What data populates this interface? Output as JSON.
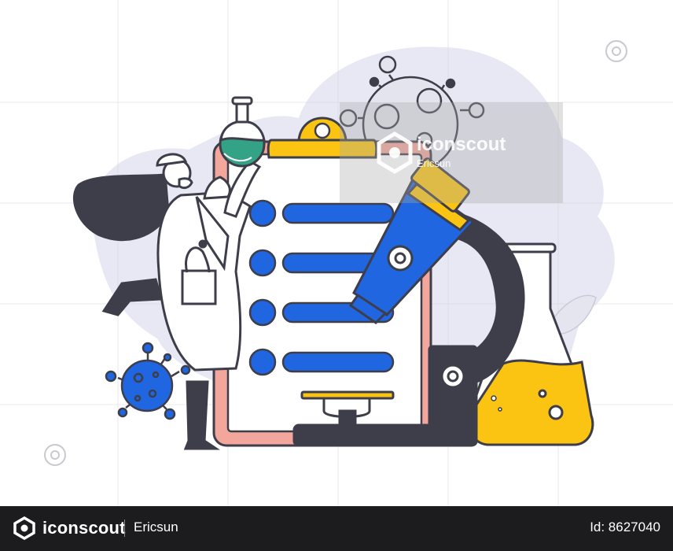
{
  "watermark": {
    "brand": "iconscout",
    "author": "Ericsun"
  },
  "footer": {
    "brand": "iconscout",
    "author": "Ericsun",
    "asset_id": "Id: 8627040"
  },
  "colors": {
    "blue": "#1f66e0",
    "yellow": "#fbc412",
    "dark": "#3d3e4a",
    "pink": "#f3a69b",
    "bg_blob": "#e6e7f2",
    "green": "#34a385",
    "footer_bg": "#1c1c1e"
  },
  "icons": [
    "flask-icon",
    "clipboard-icon",
    "microscope-icon",
    "virus-icon",
    "leaf-icon",
    "iconscout-logo-icon"
  ]
}
